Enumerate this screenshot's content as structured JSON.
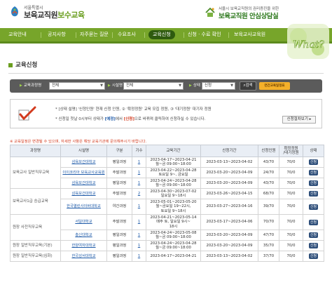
{
  "header": {
    "org_small": "서울특별시",
    "org_main": "보육교직원",
    "org_accent": "보수교육",
    "right_small": "서울시 보육교직원의 권리증진을 위한",
    "right_main": "보육교직원 안심상담실"
  },
  "nav": {
    "items": [
      "교육안내",
      "공지사항",
      "자주묻는 질문",
      "수요조사",
      "교육신청",
      "신청 · 수료 확인",
      "보육교사교육원"
    ],
    "active_index": 4
  },
  "badge_text": "What?",
  "page_title": "교육신청",
  "search": {
    "course_type_label": "교육과정명",
    "course_type_value": "전체",
    "institution_label": "시설명",
    "institution_value": "전체",
    "status_label": "상태",
    "status_value": "신청",
    "search_button": "검색",
    "pdf_button": "연간교육일정표"
  },
  "notice": {
    "line1": "* [상태 설명] '신청인원' 현재 신청 인원, ② '확정정원' 교육 모집 정원, ③ '대기정원' 대기자 정원",
    "line2_a": "* 신청일 첫날 0시부터 상태가 ",
    "line2_b": "[예정]",
    "line2_c": "에서 ",
    "line2_d": "[신청]",
    "line2_e": "으로 바뀌며 클릭하여 신청하실 수 있습니다.",
    "guide_button": "신청절차보기 ▸"
  },
  "warning": "※ 교육일정은 변경될 수 있으며, 자세한 사항은 해당 교육기관에 문의해주시기 바랍니다.",
  "table": {
    "headers": [
      "과정명",
      "시설명",
      "구분",
      "기수",
      "교육기간",
      "신청기간",
      "신청인원",
      "확정정원\n/대기정원",
      "상태"
    ],
    "rows": [
      {
        "course": "보육교사 일반직무교육",
        "inst": "삼육보건대학교",
        "type": "평일과정",
        "term": "1",
        "period": "2023-04-17~2023-04-21\n월~금 09:00~18:00",
        "apply": "2023-03-13~2023-04-02",
        "count": "43/70",
        "quota": "70/0",
        "status": "신청"
      },
      {
        "course": "",
        "inst": "이이코리아 보육교사교육원",
        "type": "주말과정",
        "term": "1",
        "period": "2023-04-22~2023-04-28\n토요일 9~, 금요일",
        "apply": "2023-03-20~2023-04-09",
        "count": "24/70",
        "quota": "70/0",
        "status": "신청"
      },
      {
        "course": "",
        "inst": "삼육보건대학교",
        "type": "평일과정",
        "term": "1",
        "period": "2023-04-24~2023-04-28\n월~금 09:00~18:00",
        "apply": "2023-03-20~2023-04-09",
        "count": "43/70",
        "quota": "70/0",
        "status": "신청"
      },
      {
        "course": "보육교사1급 승급교육",
        "inst": "삼육보건대학교",
        "type": "주말과정",
        "term": "2",
        "period": "2023-04-30~2023-07-02\n일요일 9~18시",
        "apply": "2023-03-26~2023-04-15",
        "count": "68/70",
        "quota": "70/0",
        "status": "신청"
      },
      {
        "course": "",
        "inst": "한국열린사이버대학교",
        "type": "야간과정",
        "term": "1",
        "period": "2023-05-01~2023-05-20\n월~금요일 19~22시,\n토요일 9~18시",
        "apply": "2023-03-27~2023-04-16",
        "count": "39/70",
        "quota": "70/0",
        "status": "신청"
      },
      {
        "course": "원장 사전직무교육",
        "inst": "서일대학교",
        "type": "주말과정",
        "term": "1",
        "period": "2023-04-21~2023-05-14\n매주 토, 일요일 9시~\n18시",
        "apply": "2023-03-17~2023-04-06",
        "count": "70/70",
        "quota": "70/0",
        "status": "신청"
      },
      {
        "course": "",
        "inst": "총신대학교",
        "type": "평일과정",
        "term": "1",
        "period": "2023-04-24~2023-05-08\n월~금 09:00~18:00",
        "apply": "2023-03-20~2023-04-09",
        "count": "47/70",
        "quota": "70/0",
        "status": "신청"
      },
      {
        "course": "원장 일반직무교육(기본)",
        "inst": "한양여자대학교",
        "type": "평일과정",
        "term": "1",
        "period": "2023-04-24~2023-04-28\n월~금 09:00~18:00",
        "apply": "2023-03-20~2023-04-09",
        "count": "35/70",
        "quota": "70/0",
        "status": "신청"
      },
      {
        "course": "원장 일반직무교육(심화)",
        "inst": "한국성서대학교",
        "type": "평일과정",
        "term": "1",
        "period": "2023-04-17~2023-04-21",
        "apply": "2023-03-13~2023-04-02",
        "count": "37/70",
        "quota": "70/0",
        "status": "신청"
      }
    ]
  },
  "colors": {
    "nav_green": "#77a52a",
    "accent_green": "#6a9e1f",
    "link_blue": "#1e5aa8",
    "warn_red": "#d23a1e",
    "apply_button": "#2f4f7a"
  }
}
